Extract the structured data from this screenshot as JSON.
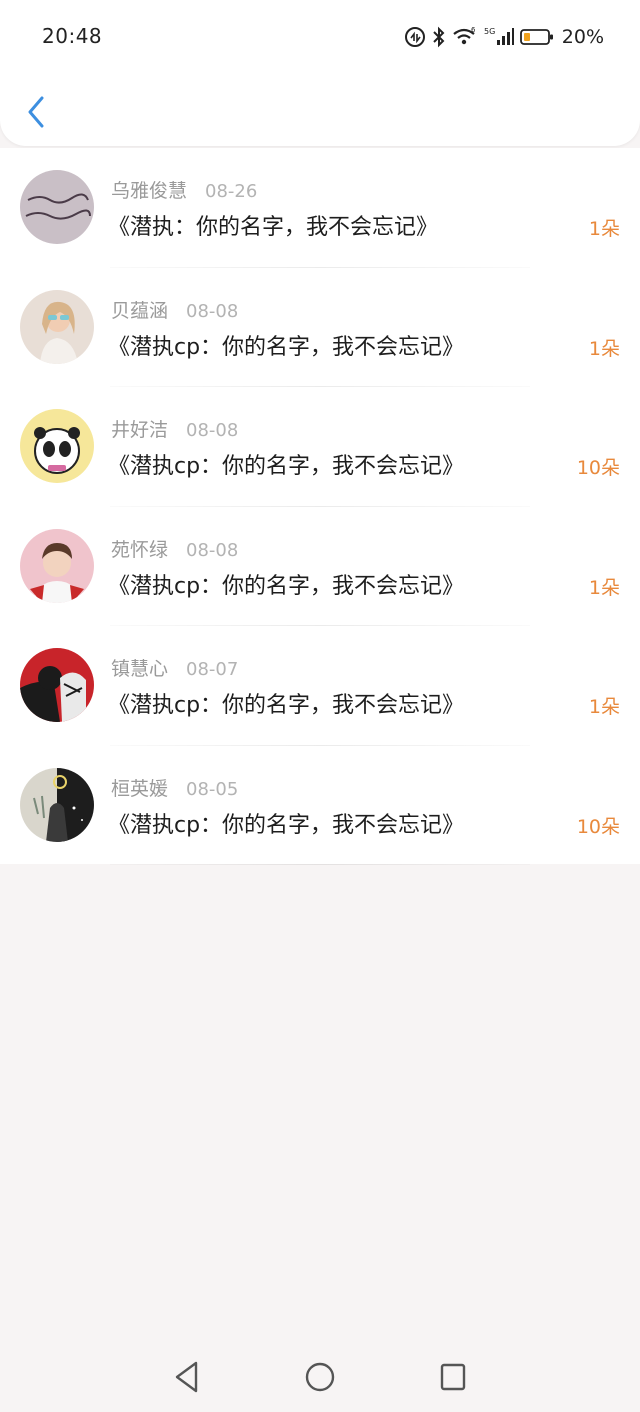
{
  "status_bar": {
    "time": "20:48",
    "battery": "20%"
  },
  "header": {
    "back_icon": "chevron-left-icon",
    "accent": "#3d8fe0"
  },
  "count_color": "#e8893c",
  "items": [
    {
      "name": "乌雅俊慧",
      "date": "08-26",
      "title": "《潜执：你的名字，我不会忘记》",
      "count": "1朵"
    },
    {
      "name": "贝蕴涵",
      "date": "08-08",
      "title": "《潜执cp：你的名字，我不会忘记》",
      "count": "1朵"
    },
    {
      "name": "井好洁",
      "date": "08-08",
      "title": "《潜执cp：你的名字，我不会忘记》",
      "count": "10朵"
    },
    {
      "name": "苑怀绿",
      "date": "08-08",
      "title": "《潜执cp：你的名字，我不会忘记》",
      "count": "1朵"
    },
    {
      "name": "镇慧心",
      "date": "08-07",
      "title": "《潜执cp：你的名字，我不会忘记》",
      "count": "1朵"
    },
    {
      "name": "桓英媛",
      "date": "08-05",
      "title": "《潜执cp：你的名字，我不会忘记》",
      "count": "10朵"
    }
  ],
  "nav": {
    "back": "triangle-back-icon",
    "home": "circle-home-icon",
    "recents": "square-recents-icon"
  }
}
